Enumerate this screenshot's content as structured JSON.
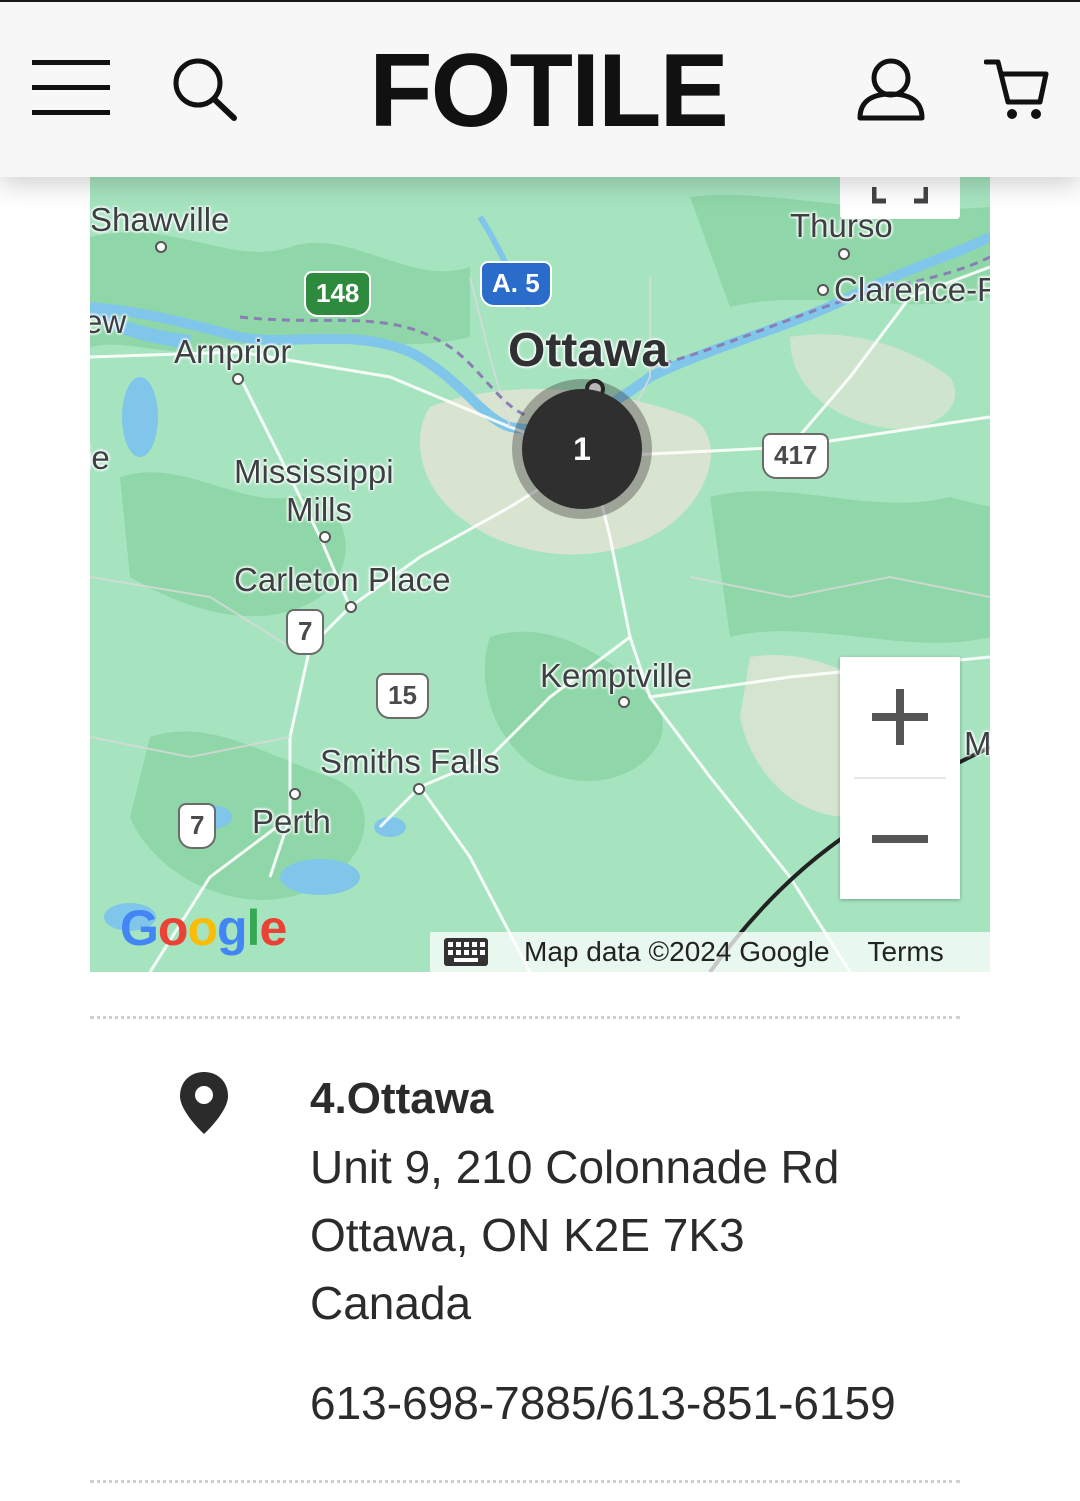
{
  "header": {
    "brand": "FOTILE",
    "menu_icon": "hamburger-menu-icon",
    "search_icon": "search-icon",
    "account_icon": "user-account-icon",
    "cart_icon": "shopping-cart-icon"
  },
  "map": {
    "labels": {
      "shawville": "Shawville",
      "thurso": "Thurso",
      "clarence": "Clarence-R",
      "ew": "ew",
      "arnprior": "Arnprior",
      "ottawa": "Ottawa",
      "ie": "ie",
      "mississippi_mills_1": "Mississippi",
      "mississippi_mills_2": "Mills",
      "carleton_place": "Carleton Place",
      "kemptville": "Kemptville",
      "smiths_falls": "Smiths Falls",
      "perth": "Perth",
      "m_edge": "M"
    },
    "shields": {
      "r148": "148",
      "a5": "A. 5",
      "r417": "417",
      "r7a": "7",
      "r15": "15",
      "r7b": "7"
    },
    "cluster_count": "1",
    "zoom_in": "+",
    "zoom_out": "−",
    "google": "Google",
    "attribution": "Map data ©2024 Google",
    "terms": "Terms",
    "colors": {
      "land": "#a6e4c0",
      "forest": "#8fd7a8",
      "urban": "#e9e4d6",
      "water": "#7fc6ea",
      "road": "#ffffff",
      "cluster": "#2f2f2f"
    }
  },
  "store": {
    "name": "4.Ottawa",
    "address_line1": "Unit 9, 210 Colonnade Rd",
    "address_line2": "Ottawa, ON K2E 7K3",
    "country": "Canada",
    "phone": "613-698-7885/613-851-6159",
    "pin_icon": "map-pin-icon"
  }
}
